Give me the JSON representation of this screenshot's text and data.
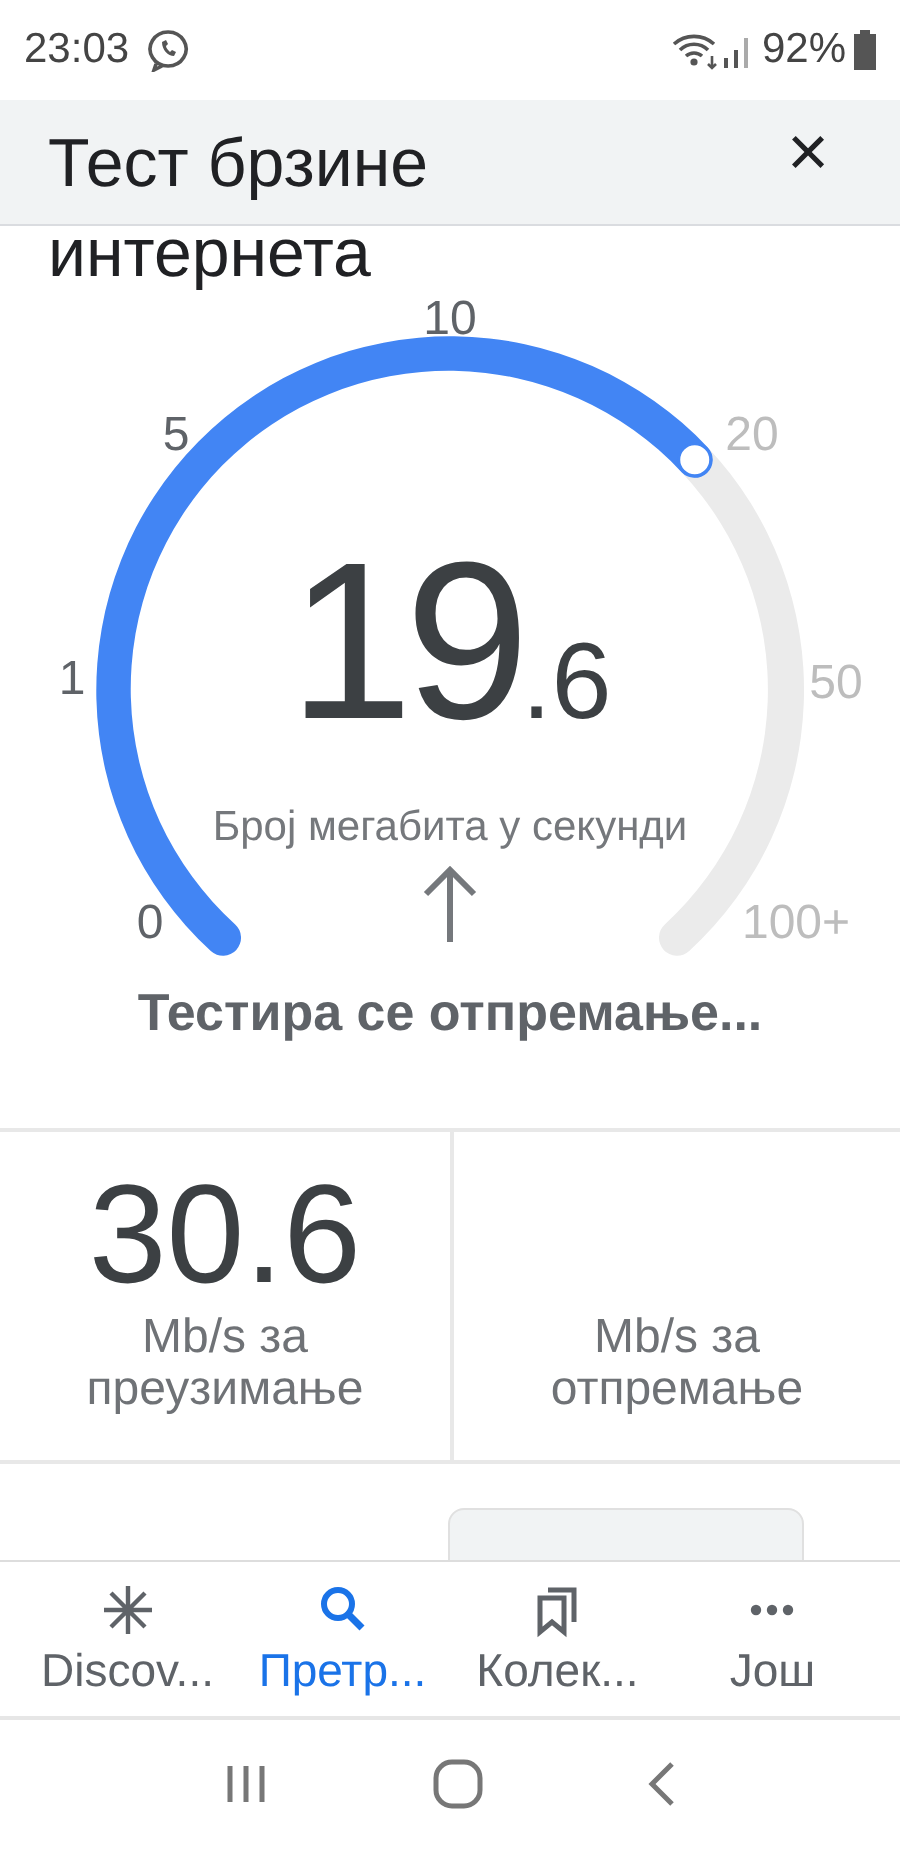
{
  "status_bar": {
    "time": "23:03",
    "battery": "92%"
  },
  "header": {
    "title": "Тест брзине интернета",
    "close": "×"
  },
  "gauge": {
    "value_whole": "19",
    "value_fraction": ".6",
    "unit": "Број мегабита у секунди",
    "ticks": [
      {
        "label": "0",
        "reached": true
      },
      {
        "label": "1",
        "reached": true
      },
      {
        "label": "5",
        "reached": true
      },
      {
        "label": "10",
        "reached": true
      },
      {
        "label": "20",
        "reached": false
      },
      {
        "label": "50",
        "reached": false
      },
      {
        "label": "100+",
        "reached": false
      }
    ]
  },
  "status": "Тестира се отпремање...",
  "results": [
    {
      "value": "30.6",
      "label": "Mb/s за преузимање"
    },
    {
      "label": "Mb/s за отпремање"
    }
  ],
  "bottom_nav": [
    {
      "label": "Discov...",
      "selected": false
    },
    {
      "label": "Претр...",
      "selected": true
    },
    {
      "label": "Колек...",
      "selected": false
    },
    {
      "label": "Још",
      "selected": false
    }
  ]
}
